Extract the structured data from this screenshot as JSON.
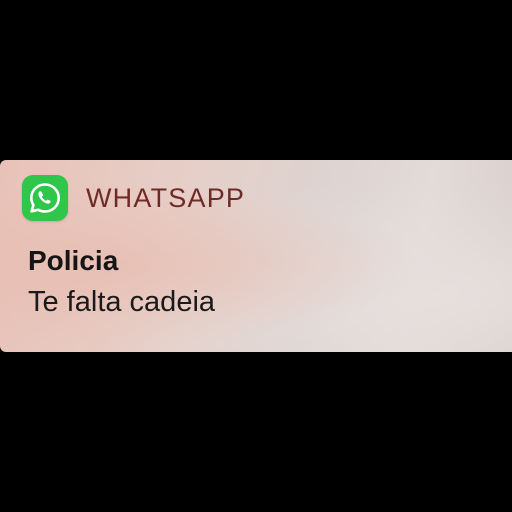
{
  "notification": {
    "app_icon": "whatsapp-icon",
    "app_name": "WHATSAPP",
    "title": "Policia",
    "message": "Te falta cadeia"
  },
  "colors": {
    "app_icon_background": "#2fc64a",
    "app_name_text": "#6e2b26",
    "title_text": "#151515",
    "message_text": "#1a1a1a",
    "screen_background": "#000000"
  }
}
